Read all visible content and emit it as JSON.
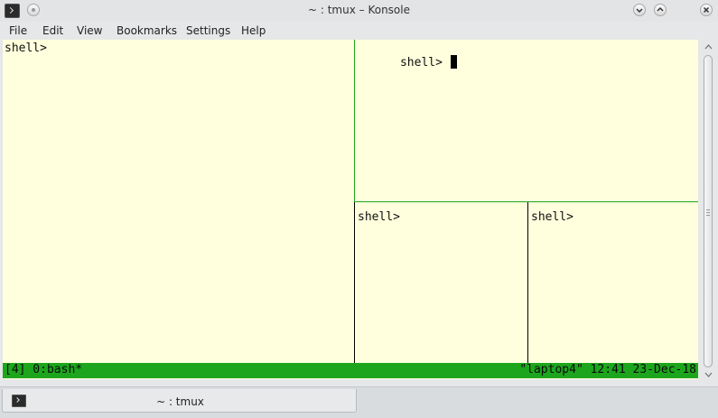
{
  "window": {
    "title": "~ : tmux – Konsole"
  },
  "menubar": {
    "file": "File",
    "edit": "Edit",
    "view": "View",
    "bookmarks": "Bookmarks",
    "settings": "Settings",
    "help": "Help"
  },
  "panes": {
    "left": {
      "prompt": "shell>"
    },
    "top_right": {
      "prompt": "shell> "
    },
    "bottom_middle": {
      "prompt": "shell>"
    },
    "bottom_right": {
      "prompt": "shell>"
    }
  },
  "statusbar": {
    "left": "[4] 0:bash*",
    "right": "\"laptop4\" 12:41 23-Dec-18"
  },
  "tabs": [
    {
      "label": "~ : tmux"
    }
  ],
  "colors": {
    "terminal_bg": "#ffffdd",
    "status_bg": "#1da61d",
    "active_border": "#1da61d",
    "inactive_border": "#000000"
  },
  "icons": {
    "app": "terminal-icon",
    "pin": "pin-icon",
    "minimize": "chevron-down-icon",
    "maximize": "chevron-up-icon",
    "close": "close-icon"
  }
}
